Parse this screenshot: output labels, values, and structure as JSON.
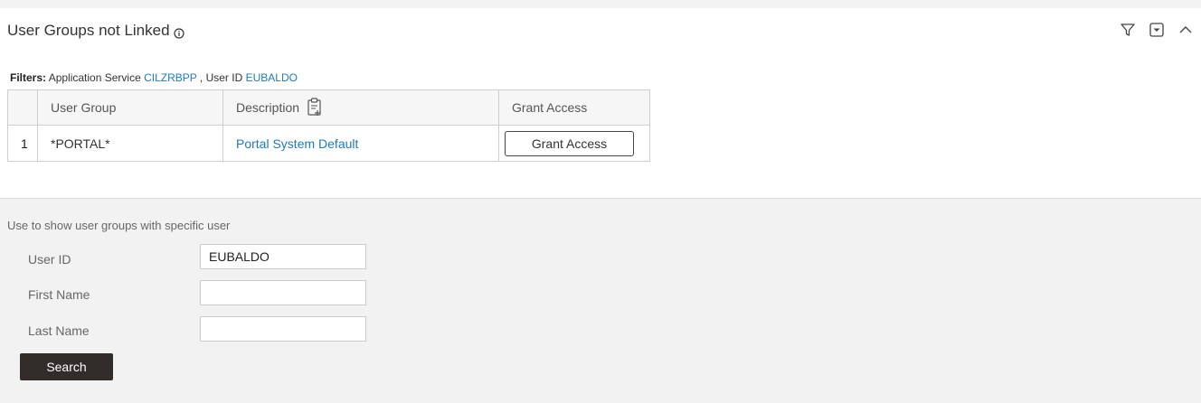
{
  "panel": {
    "title": "User Groups not Linked"
  },
  "filters": {
    "label": "Filters:",
    "service_label": "Application Service",
    "service_value": "CILZRBPP",
    "separator": ",",
    "user_label": "User ID",
    "user_value": "EUBALDO"
  },
  "table": {
    "headers": [
      "",
      "User Group",
      "Description",
      "Grant Access"
    ],
    "rows": [
      {
        "num": "1",
        "user_group": "*PORTAL*",
        "description": "Portal System Default",
        "action": "Grant Access"
      }
    ]
  },
  "search": {
    "hint": "Use to show user groups with specific user",
    "fields": [
      {
        "label": "User ID",
        "value": "EUBALDO"
      },
      {
        "label": "First Name",
        "value": ""
      },
      {
        "label": "Last Name",
        "value": ""
      }
    ],
    "button": "Search"
  },
  "icons": {
    "info": "info-icon",
    "filter": "filter-icon",
    "dropdown": "dropdown-box-icon",
    "collapse": "chevron-up-icon",
    "description_tool": "clipboard-icon"
  },
  "colors": {
    "link": "#1f7bbd",
    "search_button": "#322d2a",
    "search_panel_bg": "#f2f2f2"
  }
}
